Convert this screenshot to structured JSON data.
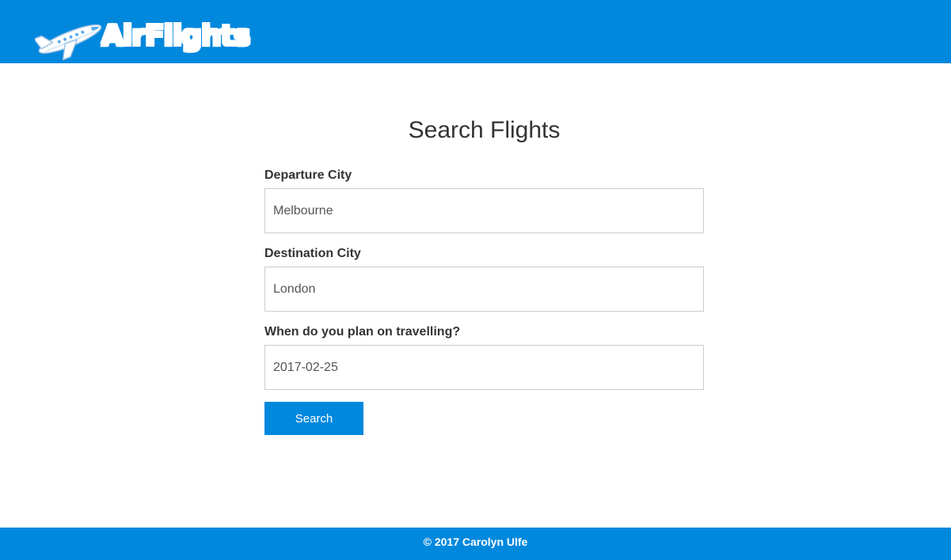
{
  "header": {
    "logo_text": "AirFlights",
    "logo_icon": "airplane-icon",
    "brand_color": "#0088dd"
  },
  "search_form": {
    "title": "Search Flights",
    "departure": {
      "label": "Departure City",
      "value": "Melbourne"
    },
    "destination": {
      "label": "Destination City",
      "value": "London"
    },
    "travel_date": {
      "label": "When do you plan on travelling?",
      "value": "2017-02-25"
    },
    "search_label": "Search"
  },
  "footer": {
    "copyright": "© 2017 Carolyn Ulfe"
  }
}
